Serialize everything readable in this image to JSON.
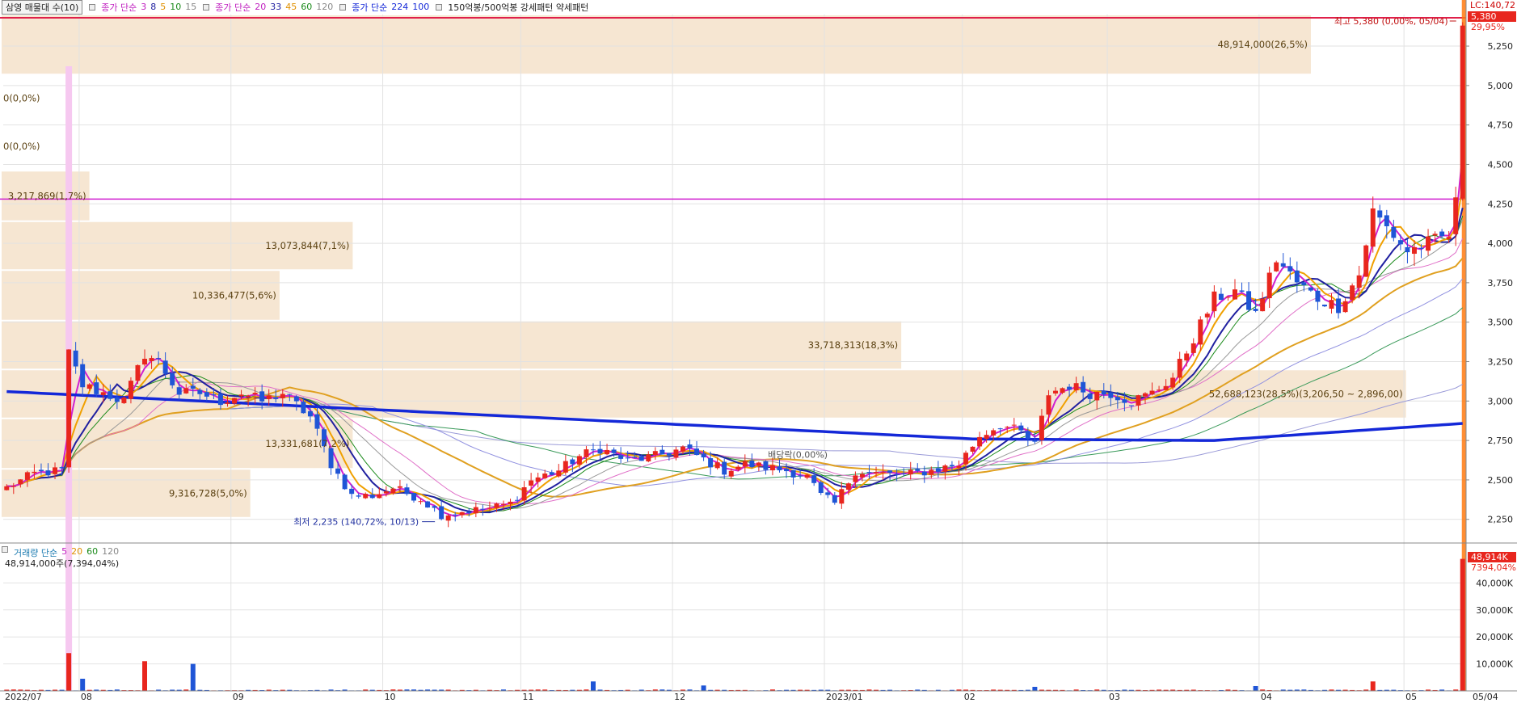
{
  "legend": {
    "title": "삼영 매물대 수(10)",
    "ma1_label": "종가 단순",
    "ma1_periods": [
      "3",
      "8",
      "5",
      "10",
      "15"
    ],
    "ma2_label": "종가 단순",
    "ma2_periods": [
      "20",
      "33",
      "45",
      "60",
      "120"
    ],
    "ma3_label": "종가 단순",
    "ma3_periods": [
      "224",
      "100"
    ],
    "pattern_text": "150억봉/500억봉 강세패턴  약세패턴",
    "lc_text": "LC:140,72"
  },
  "volume_legend": {
    "label": "거래량 단순",
    "periods": [
      "5",
      "20",
      "60",
      "120"
    ],
    "info": "48,914,000주(7,394,04%)"
  },
  "colors": {
    "up": "#e8261e",
    "down": "#1f55d6",
    "band": "#f6e6d2",
    "ma3": "#d020d0",
    "ma5": "#f0a000",
    "ma8": "#2020a0",
    "ma10": "#1a8a1a",
    "ma20": "#e060c0",
    "ma224": "#1428d8",
    "resist": "#d020d0",
    "top": "#e0204a"
  },
  "chart_data": {
    "type": "candlestick",
    "price_axis": {
      "ylim": [
        2100,
        5450
      ],
      "ticks": [
        "5,250",
        "5,000",
        "4,750",
        "4,500",
        "4,250",
        "4,000",
        "3,750",
        "3,500",
        "3,250",
        "3,000",
        "2,750",
        "2,500",
        "2,250"
      ],
      "tick_values": [
        5250,
        5000,
        4750,
        4500,
        4250,
        4000,
        3750,
        3500,
        3250,
        3000,
        2750,
        2500,
        2250
      ]
    },
    "volume_axis": {
      "ylim": [
        0,
        50000
      ],
      "ticks": [
        "40,000K",
        "30,000K",
        "20,000K",
        "10,000K"
      ],
      "tick_values": [
        40000,
        30000,
        20000,
        10000
      ]
    },
    "x_axis": {
      "labels": [
        "2022/07",
        "08",
        "09",
        "10",
        "11",
        "12",
        "2023/01",
        "02",
        "03",
        "04",
        "05",
        "05/04"
      ],
      "label_days": [
        0,
        11,
        33,
        55,
        75,
        97,
        119,
        139,
        160,
        182,
        203,
        211
      ]
    },
    "last_price": {
      "price_tag": "5,380",
      "pct_tag": "29,95%",
      "value": 5380
    },
    "last_volume": {
      "tag": "48,914K",
      "pct_tag": "7394,04%",
      "value": 48914
    },
    "volume_profile": [
      {
        "price_low": 5070,
        "price_high": 5450,
        "width_frac": 0.895,
        "label": "48,914,000(26,5%)"
      },
      {
        "price_low": 4770,
        "price_high": 5070,
        "width_frac": 0.0,
        "label": "0(0,0%)"
      },
      {
        "price_low": 4460,
        "price_high": 4770,
        "width_frac": 0.0,
        "label": "0(0,0%)"
      },
      {
        "price_low": 4140,
        "price_high": 4460,
        "width_frac": 0.06,
        "label": "3,217,869(1,7%)"
      },
      {
        "price_low": 3830,
        "price_high": 4140,
        "width_frac": 0.24,
        "label": "13,073,844(7,1%)"
      },
      {
        "price_low": 3510,
        "price_high": 3830,
        "width_frac": 0.19,
        "label": "10,336,477(5,6%)"
      },
      {
        "price_low": 3200,
        "price_high": 3510,
        "width_frac": 0.615,
        "label": "33,718,313(18,3%)"
      },
      {
        "price_low": 2890,
        "price_high": 3200,
        "width_frac": 0.96,
        "label": "52,688,123(28,5%)(3,206,50 ~ 2,896,00)"
      },
      {
        "price_low": 2570,
        "price_high": 2890,
        "width_frac": 0.24,
        "label": "13,331,681(7,2%)"
      },
      {
        "price_low": 2260,
        "price_high": 2570,
        "width_frac": 0.17,
        "label": "9,316,728(5,0%)"
      }
    ],
    "annotations": {
      "high": {
        "text": "최고 5,380 (0,00%, 05/04)",
        "value": 5380,
        "day": 211
      },
      "low": {
        "text": "최저 2,235 (140,72%, 10/13)",
        "value": 2235,
        "day": 63
      },
      "dividend": {
        "text": "배당락(0,00%)",
        "value": 2660,
        "day": 115
      }
    },
    "resistance_line": 4280,
    "highlight_day": 9,
    "pivots": [
      [
        0,
        2450
      ],
      [
        4,
        2540
      ],
      [
        8,
        2560
      ],
      [
        9,
        3300
      ],
      [
        11,
        3100
      ],
      [
        14,
        3050
      ],
      [
        17,
        3000
      ],
      [
        20,
        3300
      ],
      [
        22,
        3250
      ],
      [
        25,
        3050
      ],
      [
        28,
        3050
      ],
      [
        31,
        3000
      ],
      [
        34,
        3050
      ],
      [
        37,
        3000
      ],
      [
        40,
        3050
      ],
      [
        44,
        2900
      ],
      [
        47,
        2600
      ],
      [
        50,
        2400
      ],
      [
        53,
        2400
      ],
      [
        56,
        2450
      ],
      [
        60,
        2380
      ],
      [
        63,
        2280
      ],
      [
        66,
        2300
      ],
      [
        70,
        2320
      ],
      [
        73,
        2350
      ],
      [
        76,
        2500
      ],
      [
        80,
        2560
      ],
      [
        83,
        2650
      ],
      [
        86,
        2700
      ],
      [
        90,
        2620
      ],
      [
        94,
        2650
      ],
      [
        98,
        2700
      ],
      [
        101,
        2630
      ],
      [
        104,
        2560
      ],
      [
        107,
        2600
      ],
      [
        110,
        2580
      ],
      [
        113,
        2560
      ],
      [
        116,
        2520
      ],
      [
        118,
        2400
      ],
      [
        120,
        2350
      ],
      [
        123,
        2560
      ],
      [
        126,
        2540
      ],
      [
        130,
        2530
      ],
      [
        134,
        2560
      ],
      [
        138,
        2600
      ],
      [
        141,
        2780
      ],
      [
        144,
        2850
      ],
      [
        147,
        2800
      ],
      [
        149,
        2720
      ],
      [
        151,
        3050
      ],
      [
        154,
        3100
      ],
      [
        157,
        3050
      ],
      [
        160,
        3050
      ],
      [
        163,
        3000
      ],
      [
        166,
        3050
      ],
      [
        169,
        3150
      ],
      [
        172,
        3400
      ],
      [
        175,
        3650
      ],
      [
        178,
        3700
      ],
      [
        181,
        3550
      ],
      [
        184,
        3900
      ],
      [
        187,
        3750
      ],
      [
        190,
        3650
      ],
      [
        193,
        3600
      ],
      [
        196,
        3800
      ],
      [
        198,
        4200
      ],
      [
        200,
        4100
      ],
      [
        203,
        3950
      ],
      [
        206,
        4000
      ],
      [
        209,
        4050
      ],
      [
        210,
        4250
      ],
      [
        211,
        5380
      ]
    ],
    "volume_spikes": [
      [
        9,
        14000
      ],
      [
        11,
        4500
      ],
      [
        20,
        11000
      ],
      [
        27,
        10000
      ],
      [
        85,
        3500
      ],
      [
        101,
        2000
      ],
      [
        149,
        1500
      ],
      [
        181,
        1800
      ],
      [
        198,
        3500
      ],
      [
        211,
        48914
      ]
    ],
    "base_volume": 350
  }
}
